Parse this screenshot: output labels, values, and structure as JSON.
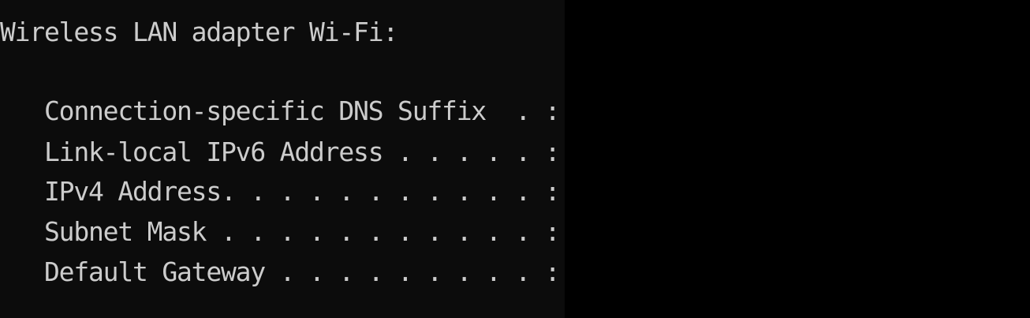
{
  "adapter_heading": "Wireless LAN adapter Wi-Fi:",
  "fields": [
    "Connection-specific DNS Suffix  . :",
    "Link-local IPv6 Address . . . . . :",
    "IPv4 Address. . . . . . . . . . . :",
    "Subnet Mask . . . . . . . . . . . :",
    "Default Gateway . . . . . . . . . :"
  ],
  "colors": {
    "background": "#0c0c0c",
    "text": "#cccccc",
    "redaction": "#000000"
  }
}
